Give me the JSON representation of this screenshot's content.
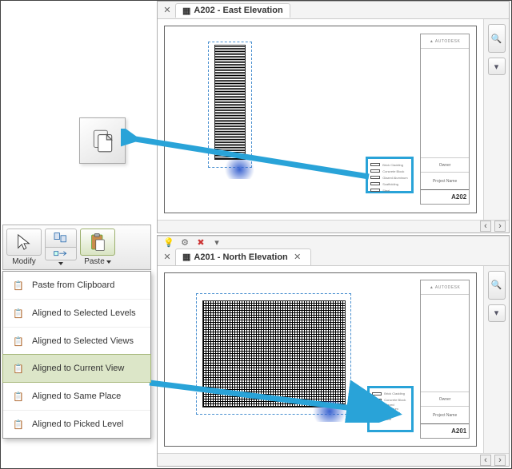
{
  "views": {
    "top": {
      "tab_label": "A202 - East Elevation",
      "sheet_number": "A202",
      "tb_logo": "▲ AUTODESK",
      "tb_owner": "Owner",
      "tb_project": "Project Name"
    },
    "bottom": {
      "tab_label": "A201 - North Elevation",
      "sheet_number": "A201",
      "tb_logo": "▲ AUTODESK",
      "tb_owner": "Owner",
      "tb_project": "Project Name"
    }
  },
  "legend": {
    "rows": [
      "Brick Cladding",
      "Concrete Block",
      "Glazed Aluminum",
      "Scaffolding",
      "Steel"
    ]
  },
  "ribbon": {
    "modify_label": "Modify",
    "paste_label": "Paste"
  },
  "paste_menu": {
    "items": {
      "clipboard": "Paste from Clipboard",
      "levels": "Aligned to Selected Levels",
      "views": "Aligned to Selected Views",
      "current": "Aligned to Current View",
      "place": "Aligned to Same Place",
      "picked": "Aligned to Picked Level"
    }
  }
}
